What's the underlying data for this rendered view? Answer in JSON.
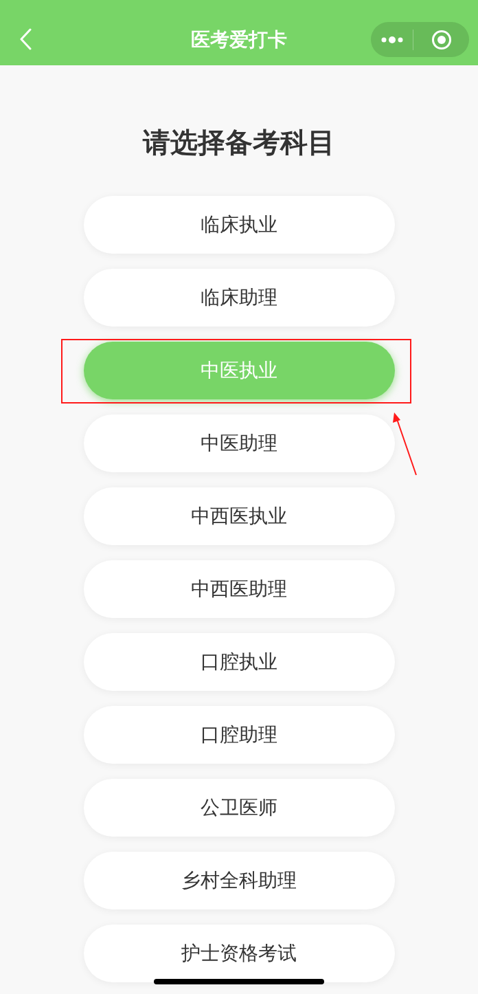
{
  "nav_bar": {
    "title": "医考爱打卡"
  },
  "heading": "请选择备考科目",
  "subjects": [
    {
      "label": "临床执业",
      "selected": false,
      "highlighted": false
    },
    {
      "label": "临床助理",
      "selected": false,
      "highlighted": false
    },
    {
      "label": "中医执业",
      "selected": true,
      "highlighted": true
    },
    {
      "label": "中医助理",
      "selected": false,
      "highlighted": false
    },
    {
      "label": "中西医执业",
      "selected": false,
      "highlighted": false
    },
    {
      "label": "中西医助理",
      "selected": false,
      "highlighted": false
    },
    {
      "label": "口腔执业",
      "selected": false,
      "highlighted": false
    },
    {
      "label": "口腔助理",
      "selected": false,
      "highlighted": false
    },
    {
      "label": "公卫医师",
      "selected": false,
      "highlighted": false
    },
    {
      "label": "乡村全科助理",
      "selected": false,
      "highlighted": false
    },
    {
      "label": "护士资格考试",
      "selected": false,
      "highlighted": false
    }
  ]
}
